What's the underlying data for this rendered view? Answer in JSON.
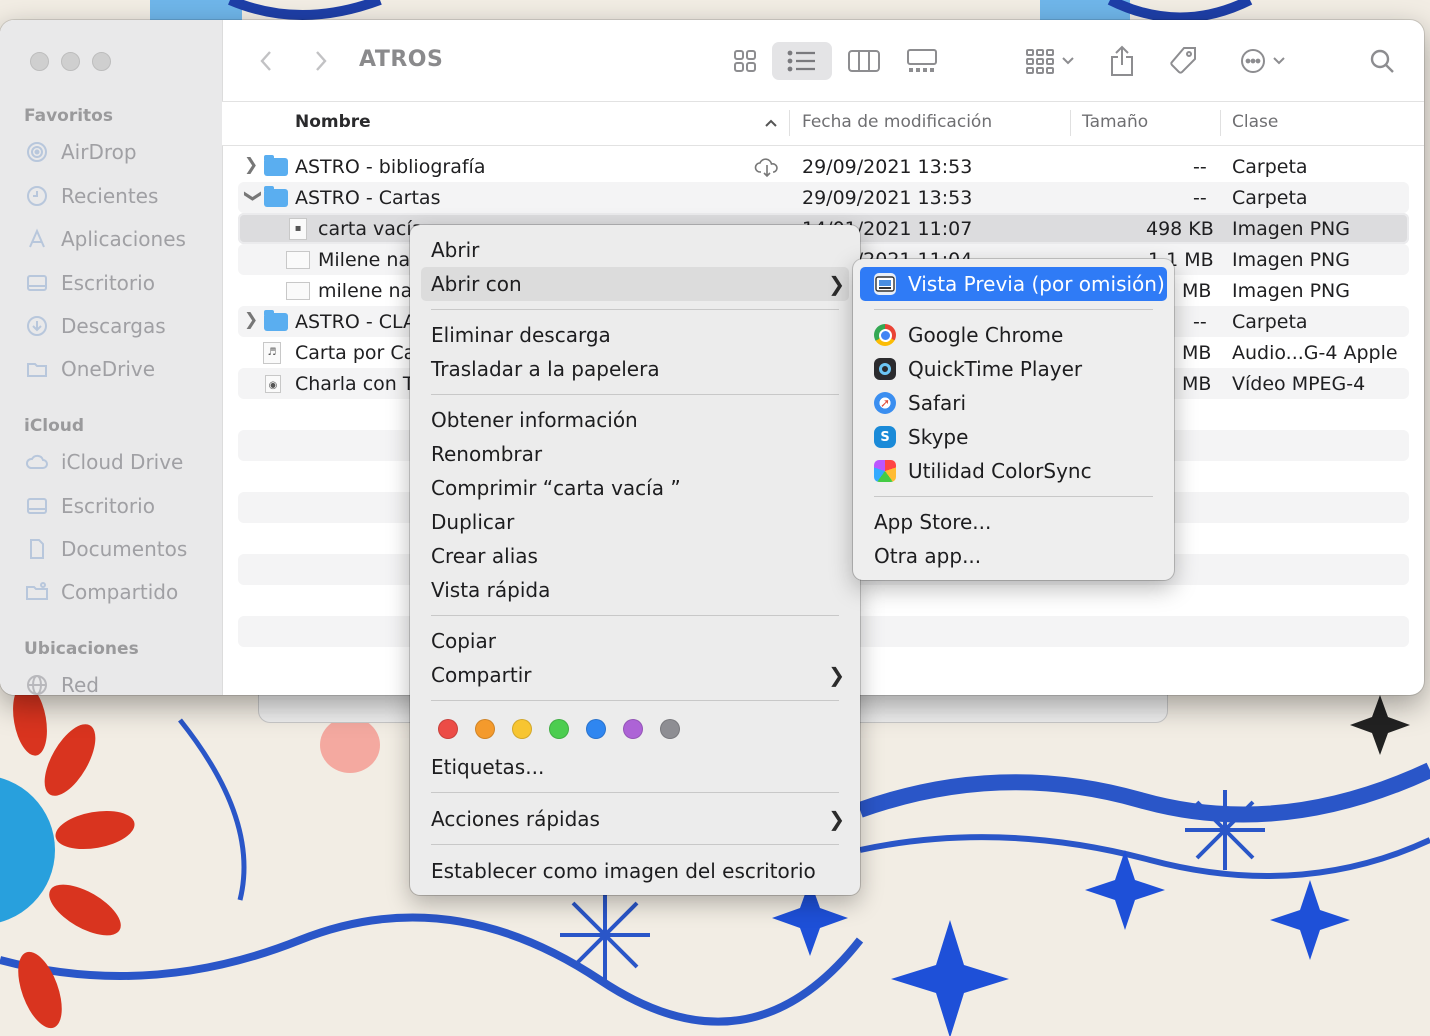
{
  "window": {
    "title": "ATROS"
  },
  "sidebar": {
    "sections": [
      {
        "title": "Favoritos",
        "items": [
          {
            "label": "AirDrop",
            "icon": "airdrop-icon"
          },
          {
            "label": "Recientes",
            "icon": "clock-icon"
          },
          {
            "label": "Aplicaciones",
            "icon": "applications-icon"
          },
          {
            "label": "Escritorio",
            "icon": "desktop-icon"
          },
          {
            "label": "Descargas",
            "icon": "downloads-icon"
          },
          {
            "label": "OneDrive",
            "icon": "folder-icon"
          }
        ]
      },
      {
        "title": "iCloud",
        "items": [
          {
            "label": "iCloud Drive",
            "icon": "cloud-icon"
          },
          {
            "label": "Escritorio",
            "icon": "desktop-icon"
          },
          {
            "label": "Documentos",
            "icon": "document-icon"
          },
          {
            "label": "Compartido",
            "icon": "shared-folder-icon"
          }
        ]
      },
      {
        "title": "Ubicaciones",
        "items": [
          {
            "label": "Red",
            "icon": "network-icon"
          }
        ]
      }
    ]
  },
  "columns": {
    "name": "Nombre",
    "date": "Fecha de modificación",
    "size": "Tamaño",
    "kind": "Clase"
  },
  "files": [
    {
      "name": "ASTRO - bibliografía",
      "date": "29/09/2021 13:53",
      "size": "--",
      "kind": "Carpeta"
    },
    {
      "name": "ASTRO - Cartas",
      "date": "29/09/2021 13:53",
      "size": "--",
      "kind": "Carpeta"
    },
    {
      "name": "carta vacía",
      "date": "14/01/2021 11:07",
      "size": "498 KB",
      "kind": "Imagen PNG"
    },
    {
      "name": "Milene nat",
      "date": "14/01/2021 11:04",
      "size": "1,1 MB",
      "kind": "Imagen PNG"
    },
    {
      "name": "milene nat",
      "size": "MB",
      "kind": "Imagen PNG"
    },
    {
      "name": "ASTRO - CLA",
      "size": "--",
      "kind": "Carpeta"
    },
    {
      "name": "Carta por Cat",
      "size": "MB",
      "kind": "Audio...G-4 Apple"
    },
    {
      "name": "Charla con Ta",
      "size": "MB",
      "kind": "Vídeo MPEG-4"
    }
  ],
  "context_menu": {
    "open": "Abrir",
    "open_with": "Abrir con",
    "remove_download": "Eliminar descarga",
    "move_to_trash": "Trasladar a la papelera",
    "get_info": "Obtener información",
    "rename": "Renombrar",
    "compress": "Comprimir “carta vacía ”",
    "duplicate": "Duplicar",
    "make_alias": "Crear alias",
    "quick_look": "Vista rápida",
    "copy": "Copiar",
    "share": "Compartir",
    "tags": "Etiquetas...",
    "quick_actions": "Acciones rápidas",
    "set_desktop_picture": "Establecer como imagen del escritorio",
    "tag_colors": [
      "#ec4c46",
      "#f49a2c",
      "#f7c531",
      "#4ccd50",
      "#2f86f0",
      "#ad63d6",
      "#8e8e93"
    ]
  },
  "submenu": {
    "default_app": "Vista Previa (por omisión)",
    "apps": [
      {
        "label": "Google Chrome",
        "icon": "chrome-icon"
      },
      {
        "label": "QuickTime Player",
        "icon": "quicktime-icon"
      },
      {
        "label": "Safari",
        "icon": "safari-icon"
      },
      {
        "label": "Skype",
        "icon": "skype-icon"
      },
      {
        "label": "Utilidad ColorSync",
        "icon": "colorsync-icon"
      }
    ],
    "app_store": "App Store...",
    "other_app": "Otra app..."
  },
  "colors": {
    "accent": "#2f7bf6",
    "folder": "#5aaef0"
  }
}
